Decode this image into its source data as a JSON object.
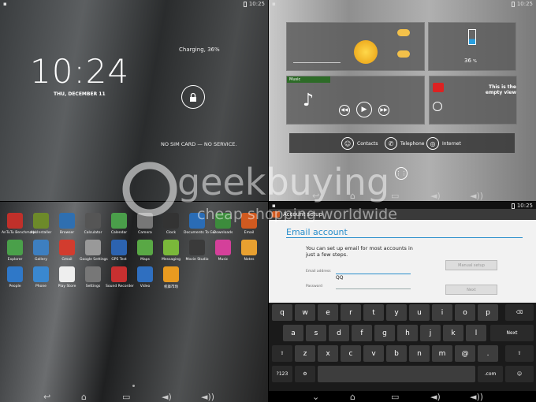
{
  "status": {
    "time": "10:25"
  },
  "lock": {
    "time": "10:24",
    "date": "THU, DECEMBER 11",
    "charging": "Charging, 36%",
    "no_service": "NO SIM CARD — NO SERVICE."
  },
  "widgets": {
    "battery_percent": "36",
    "battery_unit": "%",
    "music_label": "Music",
    "empty_view": "This is the empty view",
    "contacts": "Contacts",
    "telephone": "Telephone",
    "internet": "Internet"
  },
  "apps": [
    {
      "label": "AnTuTu Benchmark",
      "color": "#c0302a"
    },
    {
      "label": "ApkInstaller",
      "color": "#6d8a2a"
    },
    {
      "label": "Browser",
      "color": "#2f6fb0"
    },
    {
      "label": "Calculator",
      "color": "#555"
    },
    {
      "label": "Calendar",
      "color": "#4a9e4a"
    },
    {
      "label": "Camera",
      "color": "#777"
    },
    {
      "label": "Clock",
      "color": "#333"
    },
    {
      "label": "Documents To Go",
      "color": "#2a6cb5"
    },
    {
      "label": "Downloads",
      "color": "#3c8c3c"
    },
    {
      "label": "Email",
      "color": "#d05a20"
    },
    {
      "label": "Explorer",
      "color": "#4aa04a"
    },
    {
      "label": "Gallery",
      "color": "#3d7fc0"
    },
    {
      "label": "Gmail",
      "color": "#d23c2e"
    },
    {
      "label": "Google Settings",
      "color": "#999"
    },
    {
      "label": "GPS Test",
      "color": "#2c63b0"
    },
    {
      "label": "Maps",
      "color": "#59a845"
    },
    {
      "label": "Messaging",
      "color": "#7ab83a"
    },
    {
      "label": "Movie Studio",
      "color": "#3a3a3a"
    },
    {
      "label": "Music",
      "color": "#d4409a"
    },
    {
      "label": "Notes",
      "color": "#e8a030"
    },
    {
      "label": "People",
      "color": "#2f78c8"
    },
    {
      "label": "Phone",
      "color": "#3a88d0"
    },
    {
      "label": "Play Store",
      "color": "#eee"
    },
    {
      "label": "Settings",
      "color": "#777"
    },
    {
      "label": "Sound Recorder",
      "color": "#c83030"
    },
    {
      "label": "Video",
      "color": "#2f6fc0"
    },
    {
      "label": "机锋市场",
      "color": "#e89a20"
    }
  ],
  "email": {
    "bar_title": "Account setup",
    "title": "Email account",
    "desc": "You can set up email for most accounts in just a few steps.",
    "email_label": "Email address",
    "email_value": "QQ",
    "password_label": "Password",
    "manual": "Manual setup",
    "next": "Next"
  },
  "keyboard": {
    "row1": [
      "q",
      "w",
      "e",
      "r",
      "t",
      "y",
      "u",
      "i",
      "o",
      "p"
    ],
    "row2": [
      "a",
      "s",
      "d",
      "f",
      "g",
      "h",
      "j",
      "k",
      "l"
    ],
    "row3": [
      "z",
      "x",
      "c",
      "v",
      "b",
      "n",
      "m",
      "@",
      "."
    ],
    "next": "Next",
    "sym": "?123",
    "dotcom": ".com"
  },
  "watermark": {
    "brand": "geekbuying",
    "tagline": "cheap shopping worldwide"
  }
}
